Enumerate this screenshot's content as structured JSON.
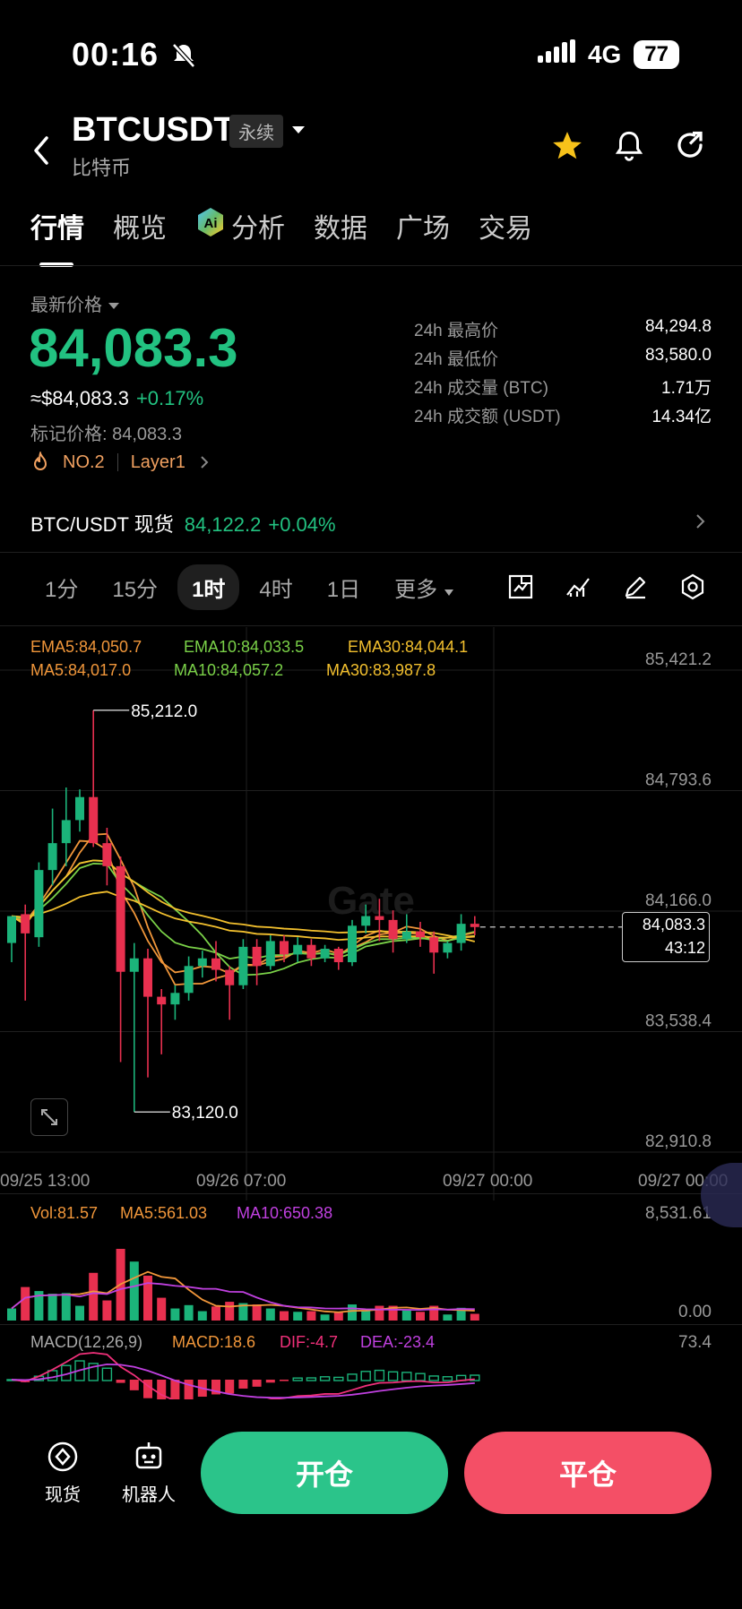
{
  "status": {
    "time": "00:16",
    "network": "4G",
    "battery": "77"
  },
  "header": {
    "symbol": "BTCUSDT",
    "contract_type": "永续",
    "name": "比特币"
  },
  "tabs": [
    {
      "label": "行情"
    },
    {
      "label": "概览"
    },
    {
      "label": "分析"
    },
    {
      "label": "数据"
    },
    {
      "label": "广场"
    },
    {
      "label": "交易"
    }
  ],
  "market": {
    "latest_label": "最新价格",
    "price": "84,083.3",
    "usd_price": "≈$84,083.3",
    "change": "+0.17%",
    "mark_price": "标记价格: 84,083.3",
    "rank": "NO.2",
    "tag": "Layer1",
    "stats": [
      {
        "label": "24h 最高价",
        "value": "84,294.8"
      },
      {
        "label": "24h 最低价",
        "value": "83,580.0"
      },
      {
        "label": "24h 成交量 (BTC)",
        "value": "1.71万"
      },
      {
        "label": "24h 成交额 (USDT)",
        "value": "14.34亿"
      }
    ]
  },
  "spot": {
    "pair": "BTC/USDT 现货",
    "price": "84,122.2",
    "change": "+0.04%"
  },
  "timeframes": [
    "1分",
    "15分",
    "1时",
    "4时",
    "1日",
    "更多"
  ],
  "chart_legend": {
    "ema5": "EMA5:84,050.7",
    "ema10": "EMA10:84,033.5",
    "ema30": "EMA30:84,044.1",
    "ma5": "MA5:84,017.0",
    "ma10": "MA10:84,057.2",
    "ma30": "MA30:83,987.8"
  },
  "volume_legend": {
    "vol": "Vol:81.57",
    "ma5": "MA5:561.03",
    "ma10": "MA10:650.38"
  },
  "macd_legend": {
    "params": "MACD(12,26,9)",
    "macd": "MACD:18.6",
    "dif": "DIF:-4.7",
    "dea": "DEA:-23.4"
  },
  "price_tag": {
    "price": "84,083.3",
    "countdown": "43:12"
  },
  "watermark": "Gate",
  "chart_data": {
    "type": "candlestick",
    "x_labels": [
      "09/25 13:00",
      "09/26 07:00",
      "09/27 00:00",
      "09/27 00:00"
    ],
    "y_labels": [
      "85,421.2",
      "84,793.6",
      "84,166.0",
      "83,538.4",
      "82,910.8"
    ],
    "ylim": [
      82910.8,
      85421.2
    ],
    "high_label": "85,212.0",
    "low_label": "83,120.0",
    "last_price": 84083.3,
    "candles": [
      {
        "o": 84000,
        "h": 84080,
        "c": 84140,
        "l": 83900
      },
      {
        "o": 84150,
        "h": 84200,
        "c": 84050,
        "l": 83700
      },
      {
        "o": 84030,
        "h": 84420,
        "c": 84380,
        "l": 83980
      },
      {
        "o": 84380,
        "h": 84700,
        "c": 84520,
        "l": 84300
      },
      {
        "o": 84520,
        "h": 84810,
        "c": 84640,
        "l": 84400
      },
      {
        "o": 84640,
        "h": 84800,
        "c": 84760,
        "l": 84580
      },
      {
        "o": 84760,
        "h": 85212,
        "c": 84520,
        "l": 84500
      },
      {
        "o": 84520,
        "h": 84600,
        "c": 84400,
        "l": 84300
      },
      {
        "o": 84400,
        "h": 84450,
        "c": 83850,
        "l": 83380
      },
      {
        "o": 83850,
        "h": 84000,
        "c": 83920,
        "l": 83120
      },
      {
        "o": 83920,
        "h": 83970,
        "c": 83720,
        "l": 83300
      },
      {
        "o": 83720,
        "h": 83760,
        "c": 83680,
        "l": 83420
      },
      {
        "o": 83680,
        "h": 83780,
        "c": 83740,
        "l": 83600
      },
      {
        "o": 83740,
        "h": 83930,
        "c": 83880,
        "l": 83700
      },
      {
        "o": 83880,
        "h": 83960,
        "c": 83920,
        "l": 83820
      },
      {
        "o": 83920,
        "h": 84010,
        "c": 83860,
        "l": 83800
      },
      {
        "o": 83860,
        "h": 83880,
        "c": 83780,
        "l": 83600
      },
      {
        "o": 83780,
        "h": 84020,
        "c": 83980,
        "l": 83760
      },
      {
        "o": 83980,
        "h": 84020,
        "c": 83880,
        "l": 83780
      },
      {
        "o": 83880,
        "h": 84040,
        "c": 84010,
        "l": 83860
      },
      {
        "o": 84010,
        "h": 84040,
        "c": 83940,
        "l": 83900
      },
      {
        "o": 83940,
        "h": 84030,
        "c": 83990,
        "l": 83900
      },
      {
        "o": 83990,
        "h": 84020,
        "c": 83920,
        "l": 83880
      },
      {
        "o": 83920,
        "h": 83990,
        "c": 83970,
        "l": 83900
      },
      {
        "o": 83970,
        "h": 83980,
        "c": 83900,
        "l": 83860
      },
      {
        "o": 83900,
        "h": 84120,
        "c": 84090,
        "l": 83880
      },
      {
        "o": 84090,
        "h": 84200,
        "c": 84140,
        "l": 84050
      },
      {
        "o": 84140,
        "h": 84230,
        "c": 84120,
        "l": 84010
      },
      {
        "o": 84120,
        "h": 84170,
        "c": 84020,
        "l": 83950
      },
      {
        "o": 84020,
        "h": 84150,
        "c": 84060,
        "l": 84000
      },
      {
        "o": 84060,
        "h": 84110,
        "c": 84030,
        "l": 83980
      },
      {
        "o": 84030,
        "h": 84060,
        "c": 83950,
        "l": 83840
      },
      {
        "o": 83950,
        "h": 84010,
        "c": 84000,
        "l": 83920
      },
      {
        "o": 84000,
        "h": 84150,
        "c": 84100,
        "l": 83960
      },
      {
        "o": 84100,
        "h": 84140,
        "c": 84083,
        "l": 84040
      }
    ]
  }
}
